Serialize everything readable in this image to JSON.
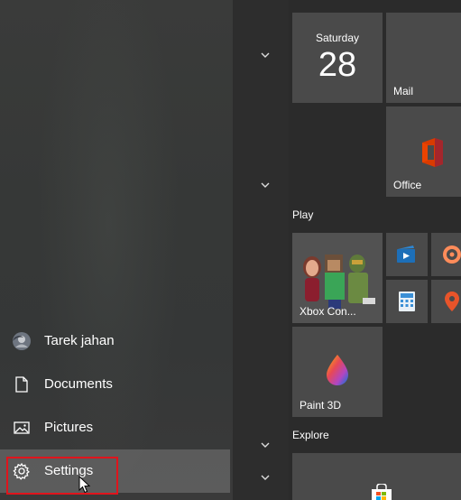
{
  "user": {
    "name": "Tarek jahan"
  },
  "nav": {
    "documents": "Documents",
    "pictures": "Pictures",
    "settings": "Settings"
  },
  "calendar": {
    "weekday": "Saturday",
    "day": "28"
  },
  "tiles": {
    "mail": "Mail",
    "office": "Office",
    "xbox": "Xbox Con...",
    "paint3d": "Paint 3D"
  },
  "groups": {
    "play": "Play",
    "explore": "Explore"
  },
  "colors": {
    "highlight": "#e0141c",
    "tile": "#4a4a4a"
  }
}
